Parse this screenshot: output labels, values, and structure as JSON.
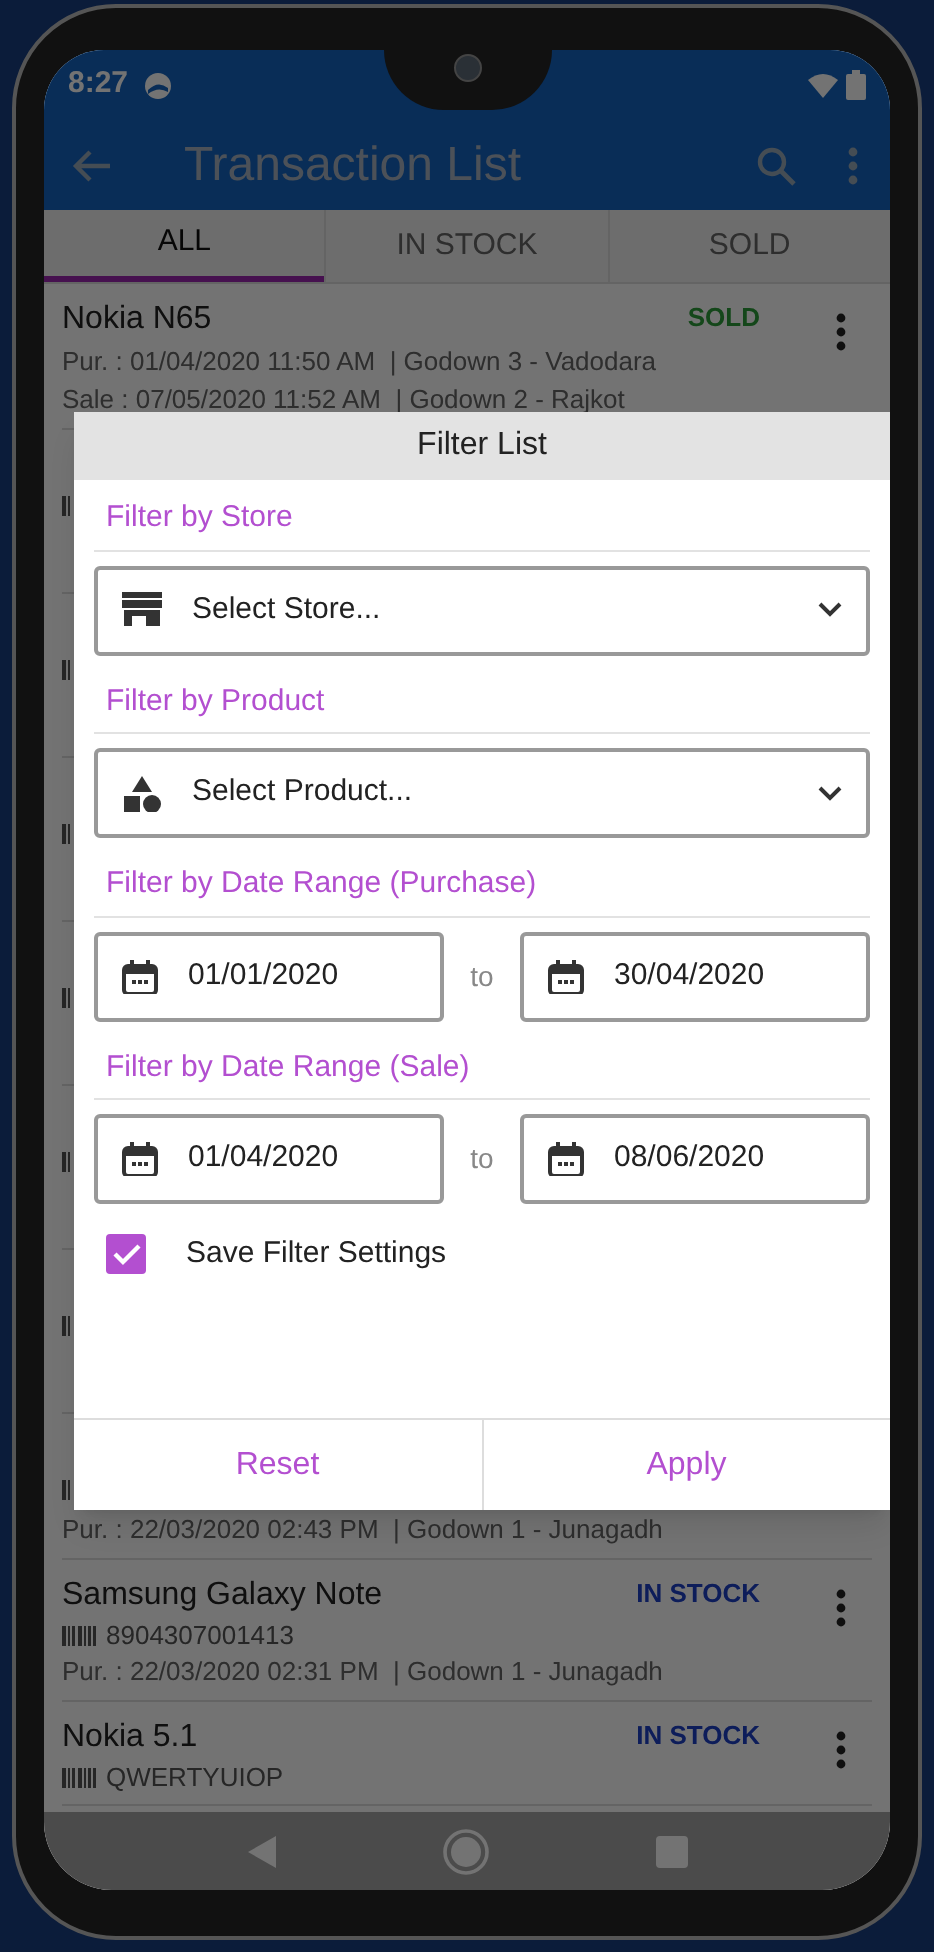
{
  "status_bar": {
    "time": "8:27"
  },
  "app_bar": {
    "title": "Transaction List"
  },
  "tabs": [
    {
      "label": "ALL",
      "selected": true
    },
    {
      "label": "IN STOCK",
      "selected": false
    },
    {
      "label": "SOLD",
      "selected": false
    }
  ],
  "list_items": [
    {
      "kind": "item",
      "name": "Nokia N65",
      "status": {
        "text": "SOLD",
        "kind": "sold"
      },
      "lines": [
        "Pur. : 01/04/2020 11:50 AM  | Godown 3 - Vadodara",
        "Sale : 07/05/2020 11:52 AM  | Godown 2 - Rajkot"
      ]
    },
    {
      "kind": "covered"
    },
    {
      "kind": "covered"
    },
    {
      "kind": "covered"
    },
    {
      "kind": "covered"
    },
    {
      "kind": "covered"
    },
    {
      "kind": "covered"
    },
    {
      "kind": "covered",
      "lines": [
        "Pur. : 22/03/2020 02:43 PM  | Godown 1 - Junagadh"
      ]
    },
    {
      "kind": "item",
      "name": "Samsung Galaxy Note",
      "status": {
        "text": "IN STOCK",
        "kind": "in_stock"
      },
      "barcode": "8904307001413",
      "lines": [
        "Pur. : 22/03/2020 02:31 PM  | Godown 1 - Junagadh"
      ]
    },
    {
      "kind": "item",
      "name": "Nokia 5.1",
      "status": {
        "text": "IN STOCK",
        "kind": "in_stock"
      },
      "barcode": "QWERTYUIOP"
    }
  ],
  "dialog": {
    "title": "Filter List",
    "sections": [
      {
        "kind": "store",
        "label": "Filter by Store",
        "placeholder": "Select Store..."
      },
      {
        "kind": "product",
        "label": "Filter by Product",
        "placeholder": "Select Product..."
      },
      {
        "kind": "date_range",
        "label": "Filter by Date Range (Purchase)",
        "from": "01/01/2020",
        "separator": "to",
        "to": "30/04/2020"
      },
      {
        "kind": "date_range",
        "label": "Filter by Date Range (Sale)",
        "from": "01/04/2020",
        "separator": "to",
        "to": "08/06/2020"
      }
    ],
    "save_filter": {
      "label": "Save Filter Settings",
      "checked": true
    },
    "buttons": [
      "Reset",
      "Apply"
    ]
  }
}
